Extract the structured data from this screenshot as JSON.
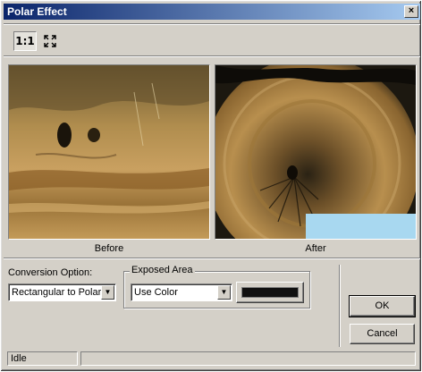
{
  "window": {
    "title": "Polar Effect",
    "close_label": "×"
  },
  "toolbar": {
    "actual_size_label": "1:1",
    "fit_icon": "fit-to-window-icon"
  },
  "previews": {
    "before_caption": "Before",
    "after_caption": "After"
  },
  "conversion": {
    "label": "Conversion Option:",
    "value": "Rectangular to Polar"
  },
  "exposed_area": {
    "legend": "Exposed Area",
    "value": "Use Color",
    "color": "#111111"
  },
  "buttons": {
    "ok": "OK",
    "cancel": "Cancel"
  },
  "status": {
    "text": "Idle",
    "progress": 0
  },
  "colors": {
    "title_start": "#0a246a",
    "title_end": "#a6caf0",
    "face": "#d4d0c8",
    "sky": "#a8d8f0"
  }
}
